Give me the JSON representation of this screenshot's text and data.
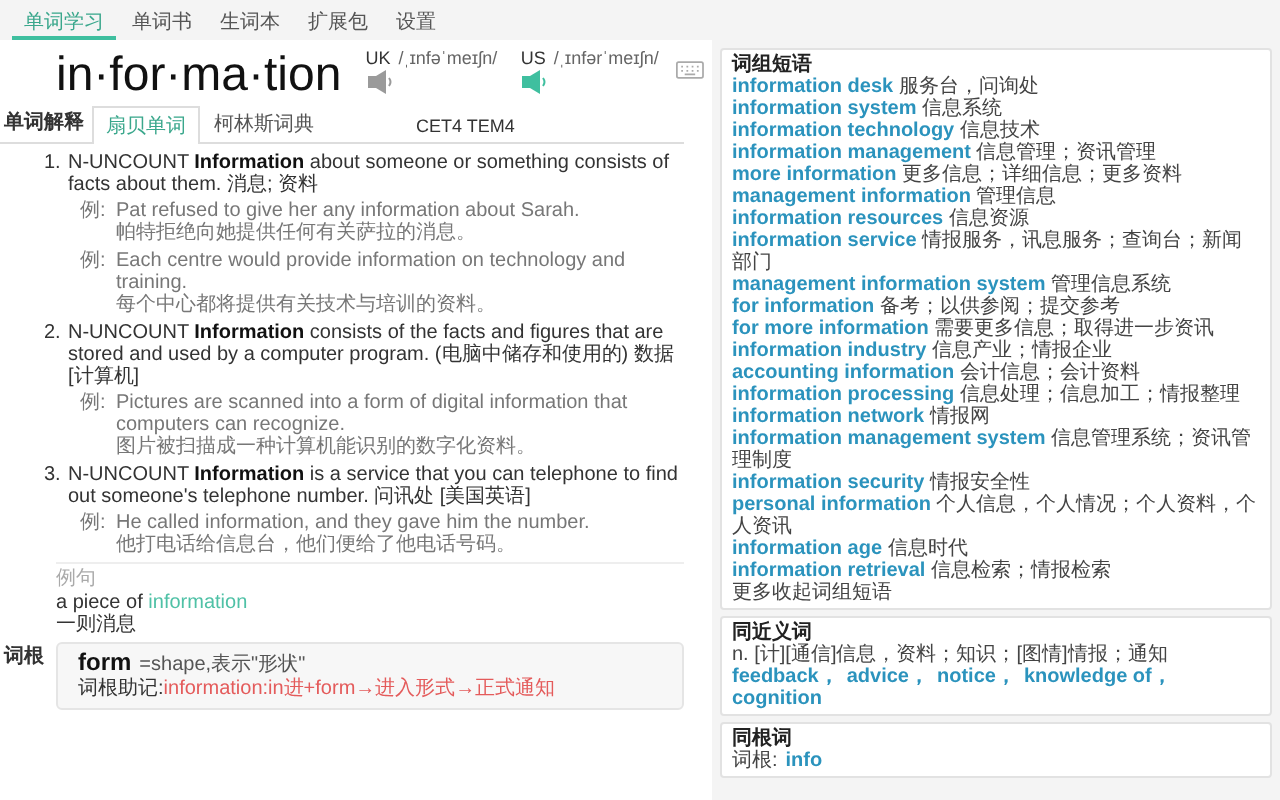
{
  "nav_tabs": [
    {
      "label": "单词学习",
      "selected": true
    },
    {
      "label": "单词书",
      "selected": false
    },
    {
      "label": "生词本",
      "selected": false
    },
    {
      "label": "扩展包",
      "selected": false
    },
    {
      "label": "设置",
      "selected": false
    }
  ],
  "word": {
    "headword": "in·for·ma·tion",
    "pronunciations": [
      {
        "region": "UK",
        "phonetic": "/ˌɪnfəˈmeɪʃn/",
        "active": false
      },
      {
        "region": "US",
        "phonetic": "/ˌɪnfərˈmeɪʃn/",
        "active": true
      }
    ]
  },
  "definitions": {
    "label": "单词解释",
    "tabs": [
      {
        "label": "扇贝单词",
        "selected": true
      },
      {
        "label": "柯林斯词典",
        "selected": false
      }
    ],
    "exam_tags": "CET4 TEM4",
    "senses": [
      {
        "number": "1.",
        "text": "N-UNCOUNT **Information** about someone or something consists of facts about them. 消息; 资料",
        "examples": [
          {
            "prefix": "例:",
            "en": "Pat refused to give her any information about Sarah.",
            "zh": "帕特拒绝向她提供任何有关萨拉的消息。"
          },
          {
            "prefix": "例:",
            "en": "Each centre would provide information on technology and training.",
            "zh": "每个中心都将提供有关技术与培训的资料。"
          }
        ]
      },
      {
        "number": "2.",
        "text": "N-UNCOUNT **Information** consists of the facts and figures that are stored and used by a computer program. (电脑中储存和使用的) 数据 [计算机]",
        "examples": [
          {
            "prefix": "例:",
            "en": "Pictures are scanned into a form of digital information that computers can recognize.",
            "zh": "图片被扫描成一种计算机能识别的数字化资料。"
          }
        ]
      },
      {
        "number": "3.",
        "text": "N-UNCOUNT **Information** is a service that you can telephone to find out someone's telephone number. 问讯处 [美国英语]",
        "examples": [
          {
            "prefix": "例:",
            "en": "He called information, and they gave him the number.",
            "zh": "他打电话给信息台，他们便给了他电话号码。"
          }
        ]
      }
    ]
  },
  "example_sentences": {
    "label": "例句",
    "items": [
      {
        "en_before": "a piece of",
        "en_highlight": "information",
        "zh": "一则消息"
      }
    ]
  },
  "root": {
    "label": "词根",
    "root": "form",
    "gloss": "=shape,表示\"形状\"",
    "mnemonic_label": "词根助记:",
    "mnemonic": "information:in进+form→进入形式→正式通知"
  },
  "phrases": {
    "title": "词组短语",
    "items": [
      {
        "en": "information desk",
        "zh": "服务台，问询处"
      },
      {
        "en": "information system",
        "zh": "信息系统"
      },
      {
        "en": "information technology",
        "zh": "信息技术"
      },
      {
        "en": "information management",
        "zh": "信息管理；资讯管理"
      },
      {
        "en": "more information",
        "zh": "更多信息；详细信息；更多资料"
      },
      {
        "en": "management information",
        "zh": "管理信息"
      },
      {
        "en": "information resources",
        "zh": "信息资源"
      },
      {
        "en": "information service",
        "zh": "情报服务，讯息服务；查询台；新闻部门"
      },
      {
        "en": "management information system",
        "zh": "管理信息系统"
      },
      {
        "en": "for information",
        "zh": "备考；以供参阅；提交参考"
      },
      {
        "en": "for more information",
        "zh": "需要更多信息；取得进一步资讯"
      },
      {
        "en": "information industry",
        "zh": "信息产业；情报企业"
      },
      {
        "en": "accounting information",
        "zh": "会计信息；会计资料"
      },
      {
        "en": "information processing",
        "zh": "信息处理；信息加工；情报整理"
      },
      {
        "en": "information network",
        "zh": "情报网"
      },
      {
        "en": "information management system",
        "zh": "信息管理系统；资讯管理制度"
      },
      {
        "en": "information security",
        "zh": "情报安全性"
      },
      {
        "en": "personal information",
        "zh": "个人信息，个人情况；个人资料，个人资讯"
      },
      {
        "en": "information age",
        "zh": "信息时代"
      },
      {
        "en": "information retrieval",
        "zh": "信息检索；情报检索"
      }
    ],
    "more": "更多收起词组短语"
  },
  "synonyms": {
    "title": "同近义词",
    "definition": "n. [计][通信]信息，资料；知识；[图情]情报；通知",
    "words": [
      {
        "word": "feedback",
        "sep": "，"
      },
      {
        "word": "advice",
        "sep": "，"
      },
      {
        "word": "notice",
        "sep": "，"
      },
      {
        "word": "knowledge of",
        "sep": "，"
      },
      {
        "word": "cognition"
      }
    ]
  },
  "cognates": {
    "title": "同根词",
    "label": "词根:",
    "root": "info"
  }
}
